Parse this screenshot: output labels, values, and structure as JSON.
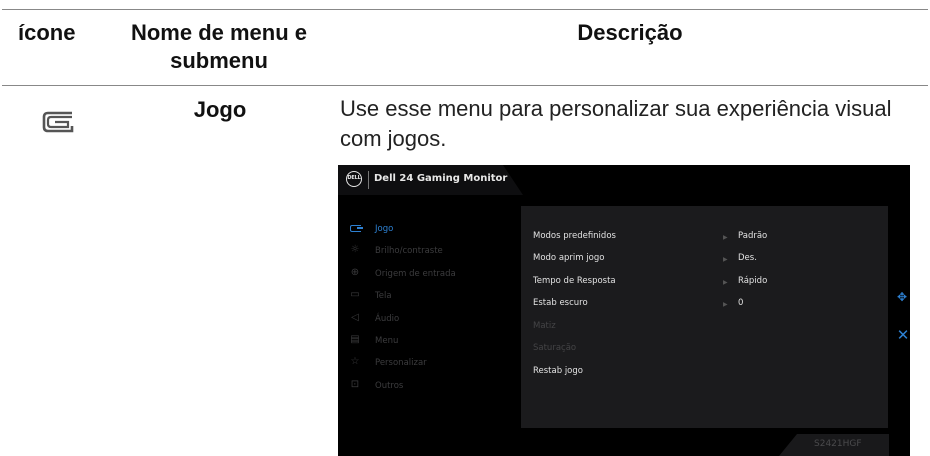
{
  "table": {
    "headers": {
      "icon": "ícone",
      "name": "Nome de menu e submenu",
      "description": "Descrição"
    },
    "row": {
      "icon": "game-icon",
      "name": "Jogo",
      "description": "Use esse menu para personalizar sua experiência visual com jogos."
    }
  },
  "osd": {
    "title": "Dell 24 Gaming Monitor",
    "logo_text": "DELL",
    "model": "S2421HGF",
    "accent_color": "#2d80d2",
    "menu": [
      {
        "label": "Jogo",
        "icon": "game-icon",
        "active": true
      },
      {
        "label": "Brilho/contraste",
        "icon": "brightness-icon",
        "active": false
      },
      {
        "label": "Origem de entrada",
        "icon": "input-source-icon",
        "active": false
      },
      {
        "label": "Tela",
        "icon": "display-icon",
        "active": false
      },
      {
        "label": "Áudio",
        "icon": "audio-icon",
        "active": false
      },
      {
        "label": "Menu",
        "icon": "menu-icon",
        "active": false
      },
      {
        "label": "Personalizar",
        "icon": "star-icon",
        "active": false
      },
      {
        "label": "Outros",
        "icon": "others-icon",
        "active": false
      }
    ],
    "submenu": [
      {
        "label": "Modos predefinidos",
        "value": "Padrão",
        "enabled": true
      },
      {
        "label": "Modo aprim jogo",
        "value": "Des.",
        "enabled": true
      },
      {
        "label": "Tempo de Resposta",
        "value": "Rápido",
        "enabled": true
      },
      {
        "label": "Estab escuro",
        "value": "0",
        "enabled": true
      },
      {
        "label": "Matiz",
        "value": "",
        "enabled": false
      },
      {
        "label": "Saturação",
        "value": "",
        "enabled": false
      },
      {
        "label": "Restab jogo",
        "value": "",
        "enabled": true
      }
    ]
  }
}
